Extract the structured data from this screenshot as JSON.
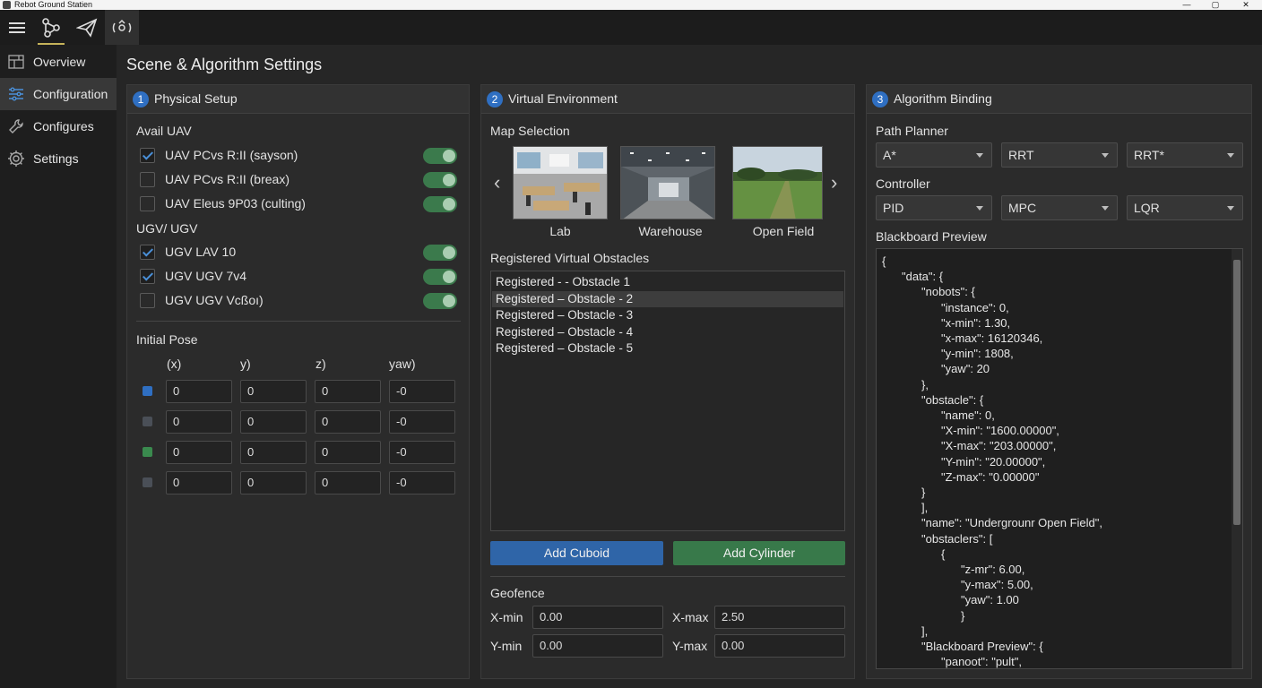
{
  "window": {
    "title": "Rebot Ground Statien",
    "min": "—",
    "max": "▢",
    "close": "✕"
  },
  "toolbar": {
    "icons": [
      "menu-icon",
      "node-graph-icon",
      "paper-plane-icon",
      "robot-sync-icon"
    ]
  },
  "sidebar": {
    "items": [
      {
        "label": "Overview",
        "icon": "grid-icon"
      },
      {
        "label": "Configuration",
        "icon": "sliders-icon"
      },
      {
        "label": "Configures",
        "icon": "wrench-icon"
      },
      {
        "label": "Settings",
        "icon": "gear-icon"
      }
    ],
    "selected": "Configuration"
  },
  "page": {
    "title": "Scene & Algorithm Settings"
  },
  "physical": {
    "num": "1",
    "title": "Physical Setup",
    "uav_heading": "Avail UAV",
    "uav": [
      {
        "label": "UAV PCvs R:II (sayson)",
        "checked": true
      },
      {
        "label": "UAV PCvs R:II (breax)",
        "checked": false
      },
      {
        "label": "UAV Eleus 9P03 (culting)",
        "checked": false
      }
    ],
    "ugv_heading": "UGV/ UGV",
    "ugv": [
      {
        "label": "UGV LAV 10",
        "checked": true
      },
      {
        "label": "UGV UGV 7v4",
        "checked": true
      },
      {
        "label": "UGV UGV Vcßoı)",
        "checked": false
      }
    ],
    "pose_heading": "Initial Pose",
    "pose_cols": [
      "(x)",
      "y)",
      "z)",
      "yaw)"
    ],
    "pose_rows": [
      {
        "color": "#2f6fc2",
        "x": "0",
        "y": "0",
        "z": "0",
        "yaw": "-0"
      },
      {
        "color": "#4a4f57",
        "x": "0",
        "y": "0",
        "z": "0",
        "yaw": "-0"
      },
      {
        "color": "#3a8a4e",
        "x": "0",
        "y": "0",
        "z": "0",
        "yaw": "-0"
      },
      {
        "color": "#4a4f57",
        "x": "0",
        "y": "0",
        "z": "0",
        "yaw": "-0"
      }
    ]
  },
  "virtual": {
    "num": "2",
    "title": "Virtual Environment",
    "map_heading": "Map Selection",
    "maps": [
      "Lab",
      "Warehouse",
      "Open Field"
    ],
    "obstacles_heading": "Registered Virtual Obstacles",
    "obstacles": [
      "Registered - - Obstacle 1",
      "Registered – Obstacle - 2",
      "Registered – Obstacle - 3",
      "Registered – Obstacle - 4",
      "Registered – Obstacle - 5"
    ],
    "selected_obstacle": 1,
    "add_cuboid": "Add Cuboid",
    "add_cylinder": "Add Cylinder",
    "geofence_heading": "Geofence",
    "geofence": {
      "xmin_label": "X-min",
      "xmin": "0.00",
      "xmax_label": "X-max",
      "xmax": "2.50",
      "ymin_label": "Y-min",
      "ymin": "0.00",
      "ymax_label": "Y-max",
      "ymax": "0.00"
    }
  },
  "algorithm": {
    "num": "3",
    "title": "Algorithm Binding",
    "planner_heading": "Path Planner",
    "planners": [
      "A*",
      "RRT",
      "RRT*"
    ],
    "controller_heading": "Controller",
    "controllers": [
      "PID",
      "MPC",
      "LQR"
    ],
    "blackboard_heading": "Blackboard Preview",
    "json_lines": [
      {
        "t": "{",
        "i": 0
      },
      {
        "t": "\"data\": {",
        "i": 1
      },
      {
        "t": "\"nobots\": {",
        "i": 2
      },
      {
        "t": "\"instance\": 0,",
        "i": 3
      },
      {
        "t": "\"x-min\": 1.30,",
        "i": 3
      },
      {
        "t": "\"x-max\": 16120346,",
        "i": 3
      },
      {
        "t": "\"y-min\": 1808,",
        "i": 3
      },
      {
        "t": "\"yaw\": 20",
        "i": 3
      },
      {
        "t": "},",
        "i": 2
      },
      {
        "t": "\"obstacle\": {",
        "i": 2
      },
      {
        "t": "\"name\": 0,",
        "i": 3
      },
      {
        "t": "\"X-min\": \"1600.00000\",",
        "i": 3
      },
      {
        "t": "\"X-max\": \"203.00000\",",
        "i": 3
      },
      {
        "t": "\"Y-min\": \"20.00000\",",
        "i": 3
      },
      {
        "t": "\"Z-max\": \"0.00000\"",
        "i": 3
      },
      {
        "t": "}",
        "i": 2
      },
      {
        "t": "],",
        "i": 2
      },
      {
        "t": "\"name\": \"Undergrounr Open Field\",",
        "i": 2
      },
      {
        "t": "\"obstaclers\": [",
        "i": 2
      },
      {
        "t": "{",
        "i": 3
      },
      {
        "t": "\"z-mr\": 6.00,",
        "i": 4
      },
      {
        "t": "\"y-max\": 5.00,",
        "i": 4
      },
      {
        "t": "\"yaw\": 1.00",
        "i": 4
      },
      {
        "t": "}",
        "i": 4
      },
      {
        "t": "],",
        "i": 2
      },
      {
        "t": "\"Blackboard Preview\": {",
        "i": 2
      },
      {
        "t": "\"panoot\": \"pult\",",
        "i": 3
      }
    ]
  }
}
